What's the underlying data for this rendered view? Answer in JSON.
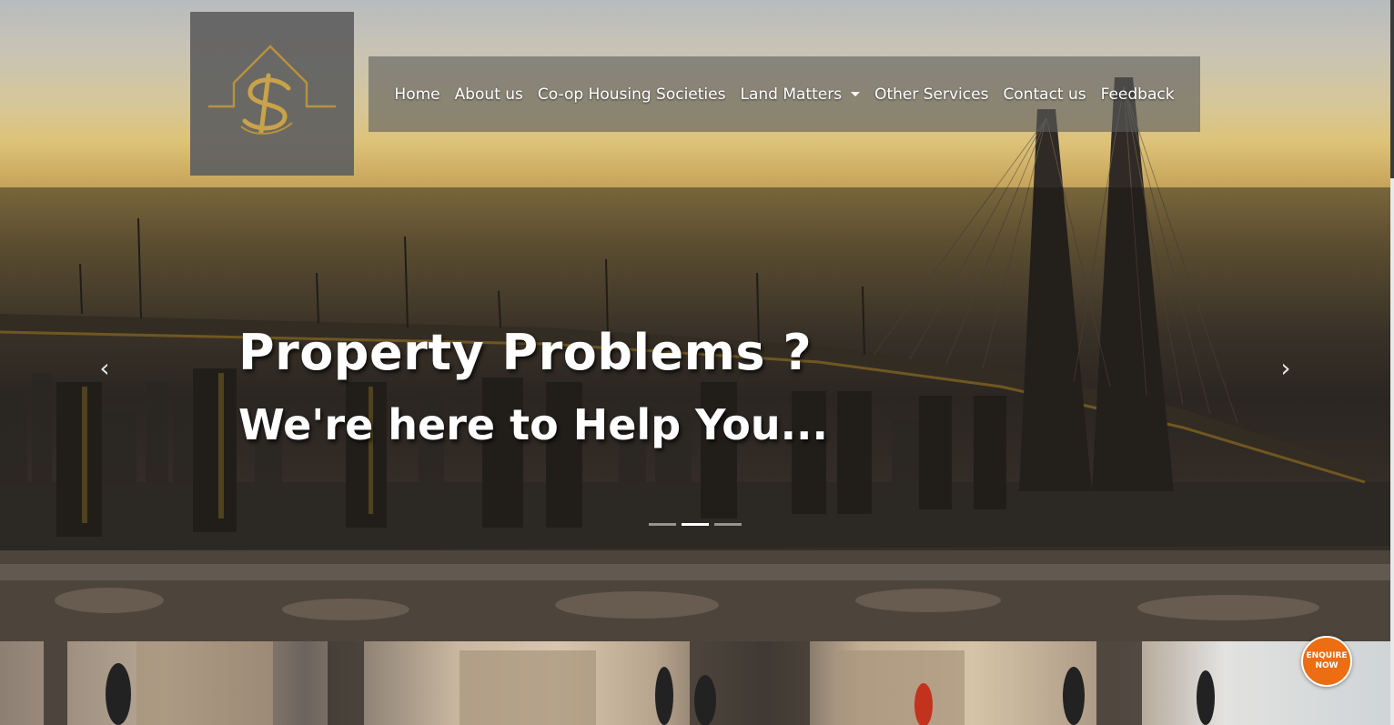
{
  "nav": {
    "items": [
      {
        "label": "Home"
      },
      {
        "label": "About us"
      },
      {
        "label": "Co-op Housing Societies"
      },
      {
        "label": "Land Matters"
      },
      {
        "label": "Other Services"
      },
      {
        "label": "Contact us"
      },
      {
        "label": "Feedback"
      }
    ]
  },
  "carousel": {
    "headline": "Property Problems ?",
    "subheadline": "We're here to Help You...",
    "active_slide": 2,
    "slide_count": 3
  },
  "enquire": {
    "line1": "ENQUIRE",
    "line2": "NOW"
  },
  "colors": {
    "logo_gold": "#b8923e",
    "enquire_orange": "#ec6d12"
  }
}
